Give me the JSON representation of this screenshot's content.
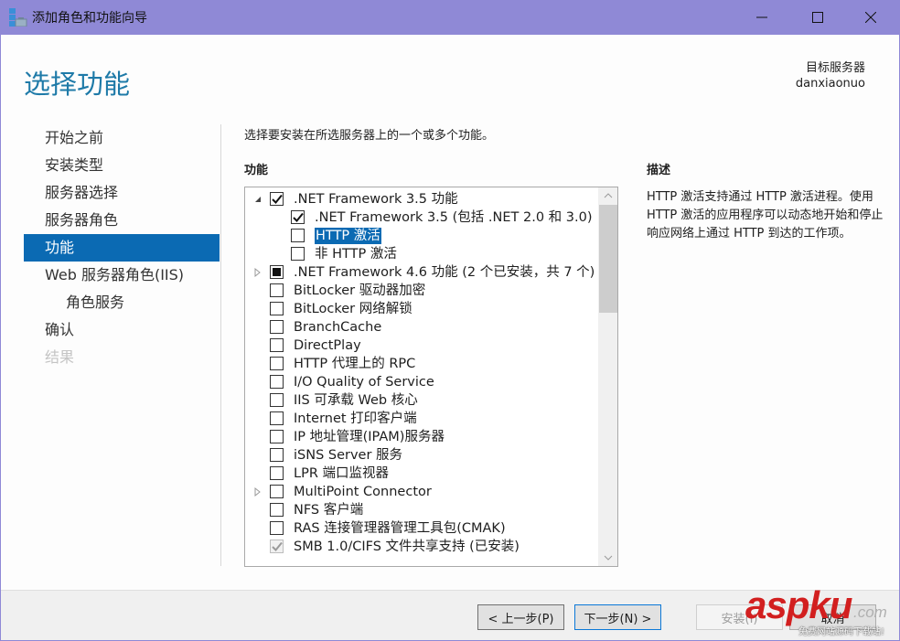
{
  "window": {
    "title": "添加角色和功能向导",
    "controls": {
      "minimize": "minimize",
      "maximize": "maximize",
      "close": "close"
    }
  },
  "header": {
    "page_title": "选择功能",
    "target_server_label": "目标服务器",
    "target_server_name": "danxiaonuo"
  },
  "nav": {
    "items": [
      {
        "label": "开始之前",
        "state": "normal"
      },
      {
        "label": "安装类型",
        "state": "normal"
      },
      {
        "label": "服务器选择",
        "state": "normal"
      },
      {
        "label": "服务器角色",
        "state": "normal"
      },
      {
        "label": "功能",
        "state": "active"
      },
      {
        "label": "Web 服务器角色(IIS)",
        "state": "normal"
      },
      {
        "label": "角色服务",
        "state": "sub"
      },
      {
        "label": "确认",
        "state": "normal"
      },
      {
        "label": "结果",
        "state": "disabled"
      }
    ]
  },
  "main": {
    "instruction": "选择要安装在所选服务器上的一个或多个功能。",
    "features_label": "功能",
    "features": [
      {
        "label": ".NET Framework 3.5 功能",
        "level": 0,
        "expander": "expanded",
        "check": "checked"
      },
      {
        "label": ".NET Framework 3.5 (包括 .NET 2.0 和 3.0)",
        "level": 1,
        "expander": "",
        "check": "checked"
      },
      {
        "label": "HTTP 激活",
        "level": 1,
        "expander": "",
        "check": "unchecked",
        "selected": true
      },
      {
        "label": "非 HTTP 激活",
        "level": 1,
        "expander": "",
        "check": "unchecked"
      },
      {
        "label": ".NET Framework 4.6 功能 (2 个已安装，共 7 个)",
        "level": 0,
        "expander": "collapsed",
        "check": "partial"
      },
      {
        "label": "BitLocker 驱动器加密",
        "level": 0,
        "expander": "",
        "check": "unchecked"
      },
      {
        "label": "BitLocker 网络解锁",
        "level": 0,
        "expander": "",
        "check": "unchecked"
      },
      {
        "label": "BranchCache",
        "level": 0,
        "expander": "",
        "check": "unchecked"
      },
      {
        "label": "DirectPlay",
        "level": 0,
        "expander": "",
        "check": "unchecked"
      },
      {
        "label": "HTTP 代理上的 RPC",
        "level": 0,
        "expander": "",
        "check": "unchecked"
      },
      {
        "label": "I/O Quality of Service",
        "level": 0,
        "expander": "",
        "check": "unchecked"
      },
      {
        "label": "IIS 可承载 Web 核心",
        "level": 0,
        "expander": "",
        "check": "unchecked"
      },
      {
        "label": "Internet 打印客户端",
        "level": 0,
        "expander": "",
        "check": "unchecked"
      },
      {
        "label": "IP 地址管理(IPAM)服务器",
        "level": 0,
        "expander": "",
        "check": "unchecked"
      },
      {
        "label": "iSNS Server 服务",
        "level": 0,
        "expander": "",
        "check": "unchecked"
      },
      {
        "label": "LPR 端口监视器",
        "level": 0,
        "expander": "",
        "check": "unchecked"
      },
      {
        "label": "MultiPoint Connector",
        "level": 0,
        "expander": "collapsed",
        "check": "unchecked"
      },
      {
        "label": "NFS 客户端",
        "level": 0,
        "expander": "",
        "check": "unchecked"
      },
      {
        "label": "RAS 连接管理器管理工具包(CMAK)",
        "level": 0,
        "expander": "",
        "check": "unchecked"
      },
      {
        "label": "SMB 1.0/CIFS 文件共享支持 (已安装)",
        "level": 0,
        "expander": "",
        "check": "installed"
      }
    ],
    "description_label": "描述",
    "description": "HTTP 激活支持通过 HTTP 激活进程。使用 HTTP 激活的应用程序可以动态地开始和停止响应网络上通过 HTTP 到达的工作项。"
  },
  "footer": {
    "prev_label": "< 上一步(P)",
    "next_label": "下一步(N) >",
    "install_label": "安装(I)",
    "cancel_label": "取消"
  },
  "watermark": {
    "brand": "aspku",
    "domain": ".com",
    "tagline": "免费网站源码下载站!"
  },
  "colors": {
    "titlebar": "#8f89d6",
    "accent": "#0b6ab3",
    "page_title": "#1e7aa8",
    "watermark": "#d21f1f"
  }
}
